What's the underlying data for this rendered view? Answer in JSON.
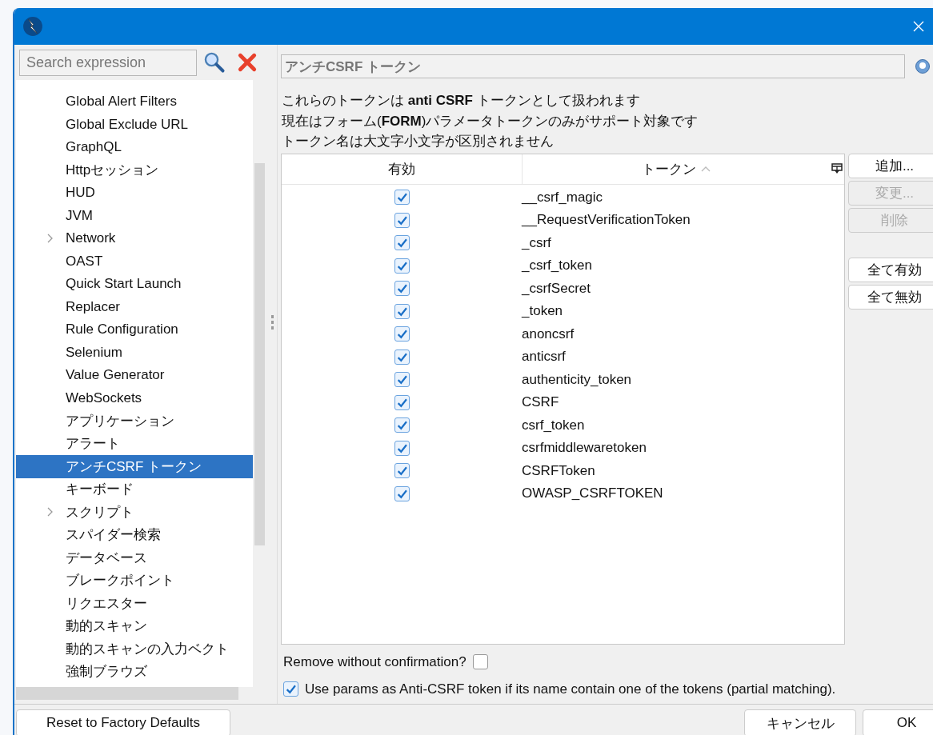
{
  "sidebar": {
    "search": {
      "placeholder": "Search expression"
    },
    "items": [
      {
        "label": "Global Alert Filters",
        "kind": "leaf",
        "selected": false
      },
      {
        "label": "Global Exclude URL",
        "kind": "leaf",
        "selected": false
      },
      {
        "label": "GraphQL",
        "kind": "leaf",
        "selected": false
      },
      {
        "label": "Httpセッション",
        "kind": "leaf",
        "selected": false
      },
      {
        "label": "HUD",
        "kind": "leaf",
        "selected": false
      },
      {
        "label": "JVM",
        "kind": "leaf",
        "selected": false
      },
      {
        "label": "Network",
        "kind": "group",
        "selected": false
      },
      {
        "label": "OAST",
        "kind": "leaf",
        "selected": false
      },
      {
        "label": "Quick Start Launch",
        "kind": "leaf",
        "selected": false
      },
      {
        "label": "Replacer",
        "kind": "leaf",
        "selected": false
      },
      {
        "label": "Rule Configuration",
        "kind": "leaf",
        "selected": false
      },
      {
        "label": "Selenium",
        "kind": "leaf",
        "selected": false
      },
      {
        "label": "Value Generator",
        "kind": "leaf",
        "selected": false
      },
      {
        "label": "WebSockets",
        "kind": "leaf",
        "selected": false
      },
      {
        "label": "アプリケーション",
        "kind": "leaf",
        "selected": false
      },
      {
        "label": "アラート",
        "kind": "leaf",
        "selected": false
      },
      {
        "label": "アンチCSRF トークン",
        "kind": "leaf",
        "selected": true
      },
      {
        "label": "キーボード",
        "kind": "leaf",
        "selected": false
      },
      {
        "label": "スクリプト",
        "kind": "group",
        "selected": false
      },
      {
        "label": "スパイダー検索",
        "kind": "leaf",
        "selected": false
      },
      {
        "label": "データベース",
        "kind": "leaf",
        "selected": false
      },
      {
        "label": "ブレークポイント",
        "kind": "leaf",
        "selected": false
      },
      {
        "label": "リクエスター",
        "kind": "leaf",
        "selected": false
      },
      {
        "label": "動的スキャン",
        "kind": "leaf",
        "selected": false
      },
      {
        "label": "動的スキャンの入力ベクト",
        "kind": "leaf",
        "selected": false
      },
      {
        "label": "強制ブラウズ",
        "kind": "leaf",
        "selected": false
      }
    ],
    "reset_button": "Reset to Factory Defaults"
  },
  "panel": {
    "title": "アンチCSRF トークン",
    "description": [
      "これらのトークンは **anti CSRF** トークンとして扱われます",
      "現在はフォーム(**FORM**)パラメータトークンのみがサポート対象です",
      "トークン名は大文字小文字が区別されません"
    ],
    "table": {
      "columns": [
        "有効",
        "トークン"
      ],
      "rows": [
        {
          "enabled": true,
          "token": "__csrf_magic"
        },
        {
          "enabled": true,
          "token": "__RequestVerificationToken"
        },
        {
          "enabled": true,
          "token": "_csrf"
        },
        {
          "enabled": true,
          "token": "_csrf_token"
        },
        {
          "enabled": true,
          "token": "_csrfSecret"
        },
        {
          "enabled": true,
          "token": "_token"
        },
        {
          "enabled": true,
          "token": "anoncsrf"
        },
        {
          "enabled": true,
          "token": "anticsrf"
        },
        {
          "enabled": true,
          "token": "authenticity_token"
        },
        {
          "enabled": true,
          "token": "CSRF"
        },
        {
          "enabled": true,
          "token": "csrf_token"
        },
        {
          "enabled": true,
          "token": "csrfmiddlewaretoken"
        },
        {
          "enabled": true,
          "token": "CSRFToken"
        },
        {
          "enabled": true,
          "token": "OWASP_CSRFTOKEN"
        }
      ]
    },
    "row_buttons": [
      {
        "label": "追加...",
        "disabled": false
      },
      {
        "label": "変更...",
        "disabled": true
      },
      {
        "label": "削除",
        "disabled": true
      }
    ],
    "bulk_buttons": [
      {
        "label": "全て有効",
        "disabled": false
      },
      {
        "label": "全て無効",
        "disabled": false
      }
    ],
    "options": [
      {
        "label": "Remove without confirmation?",
        "checked": false,
        "kind": "box_after"
      },
      {
        "label": "Use params as Anti-CSRF token if its name contain one of the tokens (partial matching).",
        "checked": true,
        "kind": "box_before"
      }
    ]
  },
  "buttons": [
    "キャンセル",
    "OK"
  ]
}
